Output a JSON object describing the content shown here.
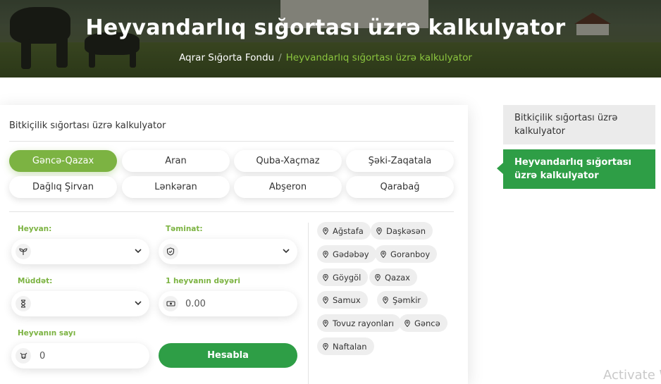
{
  "hero": {
    "title": "Heyvandarlıq sığortası üzrə kalkulyator",
    "breadcrumb": {
      "home": "Aqrar Sığorta Fondu",
      "separator": "/",
      "current": "Heyvandarlıq sığortası üzrə kalkulyator"
    }
  },
  "calculator": {
    "header": "Bitkiçilik sığortası üzrə kalkulyator",
    "regions": [
      {
        "label": "Gəncə-Qazax",
        "active": true
      },
      {
        "label": "Aran",
        "active": false
      },
      {
        "label": "Quba-Xaçmaz",
        "active": false
      },
      {
        "label": "Şəki-Zaqatala",
        "active": false
      },
      {
        "label": "Dağlıq Şirvan",
        "active": false
      },
      {
        "label": "Lənkəran",
        "active": false
      },
      {
        "label": "Abşeron",
        "active": false
      },
      {
        "label": "Qarabağ",
        "active": false
      }
    ],
    "fields": {
      "animal": {
        "label": "Heyvan:",
        "value": "",
        "icon": "plant-icon"
      },
      "coverage": {
        "label": "Təminat:",
        "value": "",
        "icon": "shield-icon"
      },
      "duration": {
        "label": "Müddət:",
        "value": "",
        "icon": "hourglass-icon"
      },
      "unit_value": {
        "label": "1 heyvanın dəyəri",
        "value": "0.00",
        "icon": "money-icon"
      },
      "count": {
        "label": "Heyvanın sayı",
        "value": "0",
        "icon": "cow-icon"
      }
    },
    "calculate_label": "Hesabla",
    "districts": [
      "Ağstafa",
      "Daşkəsən",
      "Gədəbəy",
      "Goranboy",
      "Göygöl",
      "Qazax",
      "Samux",
      "Şəmkir",
      "Tovuz rayonları",
      "Gəncə",
      "Naftalan"
    ]
  },
  "sidebar": {
    "items": [
      {
        "label": "Bitkiçilik sığortası üzrə kalkulyator",
        "active": false
      },
      {
        "label": "Heyvandarlıq sığortası üzrə kalkulyator",
        "active": true
      }
    ]
  },
  "watermark": "Activate W",
  "colors": {
    "accent": "#2e9e46",
    "accent_light": "#7cb342",
    "chip_bg": "#eeeeee",
    "sidebar_bg": "#ebebeb"
  }
}
